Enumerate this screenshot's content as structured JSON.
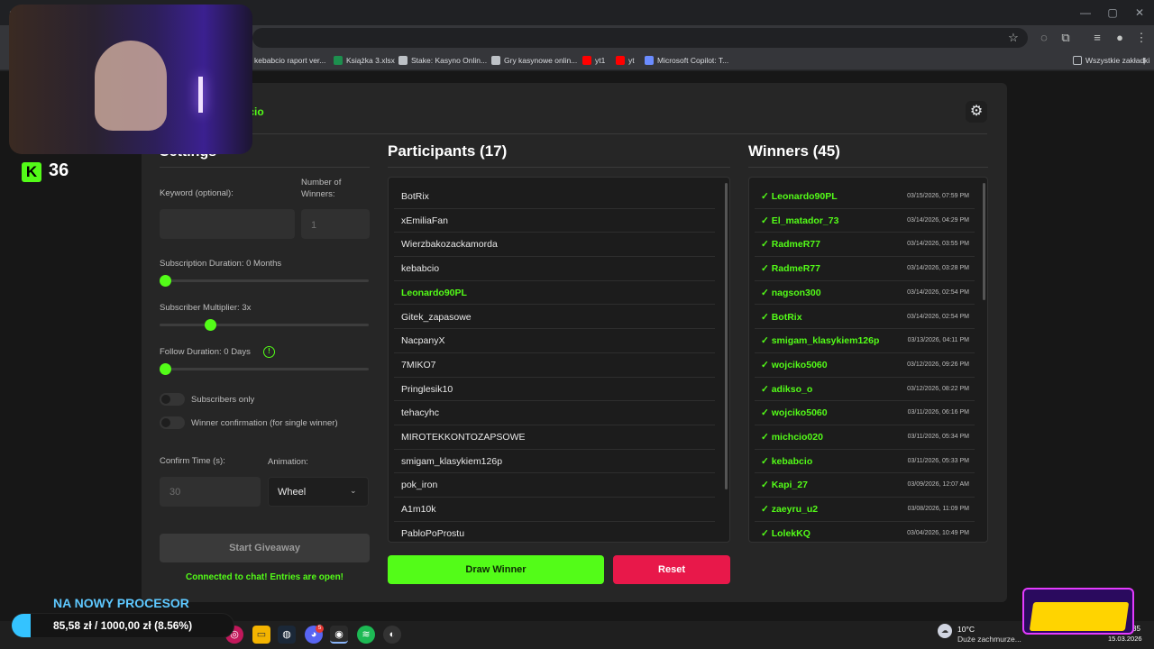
{
  "browser": {
    "bookmarks": [
      {
        "label": "kebabcio raport ver...",
        "icon": "doc-icon",
        "color": "#9aa0a6"
      },
      {
        "label": "Książka 3.xlsx",
        "icon": "excel-icon",
        "color": "#1d8f4e"
      },
      {
        "label": "Stake: Kasyno Onlin...",
        "icon": "stake-icon",
        "color": "#bdc1c6"
      },
      {
        "label": "Gry kasynowe onlin...",
        "icon": "stake-icon",
        "color": "#bdc1c6"
      },
      {
        "label": "yt1",
        "icon": "youtube-icon",
        "color": "#ff0000"
      },
      {
        "label": "yt",
        "icon": "youtube-icon",
        "color": "#ff0000"
      },
      {
        "label": "Microsoft Copilot: T...",
        "icon": "copilot-icon",
        "color": "#6b8cff"
      }
    ],
    "all_bookmarks": "Wszystkie zakładki"
  },
  "app": {
    "channel": "bcio",
    "settings_title": "Settings",
    "keyword_label": "Keyword (optional):",
    "winners_label": "Number of Winners:",
    "winners_value": "1",
    "sub_duration_label": "Subscription Duration: 0 Months",
    "sub_multiplier_label": "Subscriber Multiplier: 3x",
    "follow_duration_label": "Follow Duration:  0  Days",
    "subscribers_only": "Subscribers only",
    "winner_confirmation": "Winner confirmation (for single winner)",
    "confirm_time_label": "Confirm Time (s):",
    "confirm_time_value": "30",
    "animation_label": "Animation:",
    "animation_value": "Wheel",
    "start_button": "Start Giveaway",
    "status": "Connected to chat! Entries are open!",
    "sliders": {
      "sub_duration": 0.0,
      "sub_multiplier": 0.23,
      "follow_duration": 0.0
    },
    "participants_title": "Participants (17)",
    "participants": [
      {
        "name": "BotRix",
        "winner": false
      },
      {
        "name": "xEmiliaFan",
        "winner": false
      },
      {
        "name": "Wierzbakozackamorda",
        "winner": false
      },
      {
        "name": "kebabcio",
        "winner": false
      },
      {
        "name": "Leonardo90PL",
        "winner": true
      },
      {
        "name": "Gitek_zapasowe",
        "winner": false
      },
      {
        "name": "NacpanyX",
        "winner": false
      },
      {
        "name": "7MIKO7",
        "winner": false
      },
      {
        "name": "Pringlesik10",
        "winner": false
      },
      {
        "name": "tehacyhc",
        "winner": false
      },
      {
        "name": "MIROTEKKONTOZAPSOWE",
        "winner": false
      },
      {
        "name": "smigam_klasykiem126p",
        "winner": false
      },
      {
        "name": "pok_iron",
        "winner": false
      },
      {
        "name": "A1m10k",
        "winner": false
      },
      {
        "name": "PabloPoProstu",
        "winner": false
      }
    ],
    "winners_title": "Winners (45)",
    "winners": [
      {
        "name": "✓ Leonardo90PL",
        "date": "03/15/2026, 07:59 PM"
      },
      {
        "name": "✓ El_matador_73",
        "date": "03/14/2026, 04:29 PM"
      },
      {
        "name": "✓ RadmeR77",
        "date": "03/14/2026, 03:55 PM"
      },
      {
        "name": "✓ RadmeR77",
        "date": "03/14/2026, 03:28 PM"
      },
      {
        "name": "✓ nagson300",
        "date": "03/14/2026, 02:54 PM"
      },
      {
        "name": "✓ BotRix",
        "date": "03/14/2026, 02:54 PM"
      },
      {
        "name": "✓ smigam_klasykiem126p",
        "date": "03/13/2026, 04:11 PM"
      },
      {
        "name": "✓ wojciko5060",
        "date": "03/12/2026, 09:26 PM"
      },
      {
        "name": "✓ adikso_o",
        "date": "03/12/2026, 08:22 PM"
      },
      {
        "name": "✓ wojciko5060",
        "date": "03/11/2026, 06:16 PM"
      },
      {
        "name": "✓ michcio020",
        "date": "03/11/2026, 05:34 PM"
      },
      {
        "name": "✓ kebabcio",
        "date": "03/11/2026, 05:33 PM"
      },
      {
        "name": "✓ Kapi_27",
        "date": "03/09/2026, 12:07 AM"
      },
      {
        "name": "✓ zaeyru_u2",
        "date": "03/08/2026, 11:09 PM"
      },
      {
        "name": "✓ LolekKQ",
        "date": "03/04/2026, 10:49 PM"
      }
    ],
    "draw_button": "Draw Winner",
    "reset_button": "Reset"
  },
  "overlay": {
    "kick_count": "36",
    "goal_title": "NA NOWY PROCESOR",
    "goal_text": "85,58 zł / 1000,00 zł (8.56%)",
    "goal_progress": 0.0856
  },
  "taskbar": {
    "weather_temp": "10°C",
    "weather_desc": "Duże zachmurze...",
    "time": "35",
    "date": "15.03.2026",
    "discord_badge": "5"
  },
  "colors": {
    "accent": "#53fc18",
    "reset": "#e8184a"
  }
}
